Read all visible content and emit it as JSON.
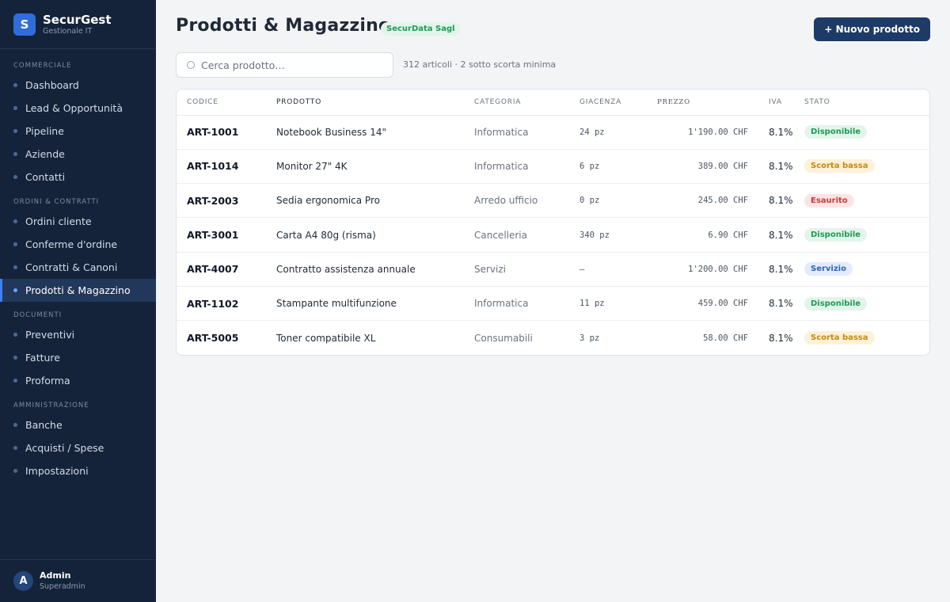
{
  "brand": {
    "logo_letter": "S",
    "name": "SecurGest",
    "subtitle": "Gestionale IT"
  },
  "sidebar": {
    "sections": [
      {
        "title": "COMMERCIALE",
        "items": [
          "Dashboard",
          "Lead & Opportunità",
          "Pipeline",
          "Aziende",
          "Contatti"
        ]
      },
      {
        "title": "ORDINI & CONTRATTI",
        "items": [
          "Ordini cliente",
          "Conferme d'ordine",
          "Contratti & Canoni",
          "Prodotti & Magazzino"
        ]
      },
      {
        "title": "DOCUMENTI",
        "items": [
          "Preventivi",
          "Fatture",
          "Proforma"
        ]
      },
      {
        "title": "AMMINISTRAZIONE",
        "items": [
          "Banche",
          "Acquisti / Spese",
          "Impostazioni"
        ]
      }
    ],
    "active_item": "Prodotti & Magazzino"
  },
  "user": {
    "initial": "A",
    "name": "Admin",
    "role": "Superadmin"
  },
  "header": {
    "title": "Prodotti & Magazzino",
    "company_badge": "SecurData Sagl",
    "new_button": "+ Nuovo prodotto"
  },
  "search": {
    "placeholder": "Cerca prodotto…",
    "value": ""
  },
  "stats": "312 articoli · 2 sotto scorta minima",
  "table": {
    "columns": [
      "CODICE",
      "PRODOTTO",
      "CATEGORIA",
      "GIACENZA",
      "PREZZO",
      "IVA",
      "STATO"
    ],
    "rows": [
      {
        "code": "ART-1001",
        "product": "Notebook Business 14\"",
        "category": "Informatica",
        "stock": "24 pz",
        "price": "1'190.00 CHF",
        "vat": "8.1%",
        "status": "Disponibile",
        "status_type": "ok"
      },
      {
        "code": "ART-1014",
        "product": "Monitor 27\" 4K",
        "category": "Informatica",
        "stock": "6 pz",
        "price": "389.00 CHF",
        "vat": "8.1%",
        "status": "Scorta bassa",
        "status_type": "low"
      },
      {
        "code": "ART-2003",
        "product": "Sedia ergonomica Pro",
        "category": "Arredo ufficio",
        "stock": "0 pz",
        "price": "245.00 CHF",
        "vat": "8.1%",
        "status": "Esaurito",
        "status_type": "out"
      },
      {
        "code": "ART-3001",
        "product": "Carta A4 80g (risma)",
        "category": "Cancelleria",
        "stock": "340 pz",
        "price": "6.90 CHF",
        "vat": "8.1%",
        "status": "Disponibile",
        "status_type": "ok"
      },
      {
        "code": "ART-4007",
        "product": "Contratto assistenza annuale",
        "category": "Servizi",
        "stock": "—",
        "price": "1'200.00 CHF",
        "vat": "8.1%",
        "status": "Servizio",
        "status_type": "svc"
      },
      {
        "code": "ART-1102",
        "product": "Stampante multifunzione",
        "category": "Informatica",
        "stock": "11 pz",
        "price": "459.00 CHF",
        "vat": "8.1%",
        "status": "Disponibile",
        "status_type": "ok"
      },
      {
        "code": "ART-5005",
        "product": "Toner compatibile XL",
        "category": "Consumabili",
        "stock": "3 pz",
        "price": "58.00 CHF",
        "vat": "8.1%",
        "status": "Scorta bassa",
        "status_type": "low"
      }
    ]
  }
}
